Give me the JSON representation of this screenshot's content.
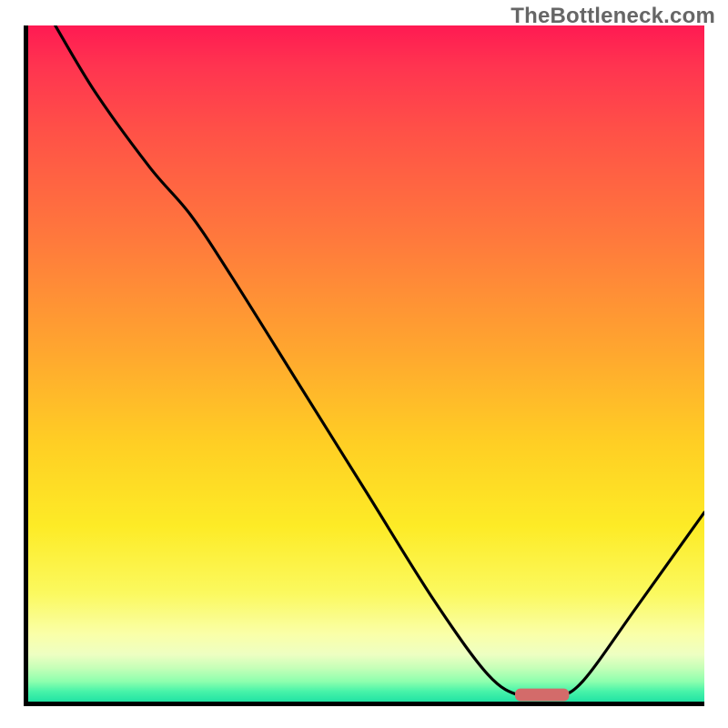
{
  "watermark": "TheBottleneck.com",
  "chart_data": {
    "type": "line",
    "title": "",
    "xlabel": "",
    "ylabel": "",
    "ylim": [
      0,
      100
    ],
    "xlim": [
      0,
      100
    ],
    "legend": false,
    "grid": false,
    "curve_points": [
      {
        "x": 4,
        "y": 100
      },
      {
        "x": 10,
        "y": 90
      },
      {
        "x": 18,
        "y": 79
      },
      {
        "x": 24,
        "y": 72
      },
      {
        "x": 30,
        "y": 63
      },
      {
        "x": 40,
        "y": 47
      },
      {
        "x": 50,
        "y": 31
      },
      {
        "x": 60,
        "y": 15
      },
      {
        "x": 68,
        "y": 4
      },
      {
        "x": 73,
        "y": 0.8
      },
      {
        "x": 78,
        "y": 0.8
      },
      {
        "x": 82,
        "y": 3
      },
      {
        "x": 90,
        "y": 14
      },
      {
        "x": 100,
        "y": 28
      }
    ],
    "optimal_zone": {
      "x_start": 72,
      "x_end": 80,
      "y": 1
    },
    "marker_color": "#d36b6a",
    "curve_color": "#000000",
    "gradient_stops": [
      {
        "pos": 0,
        "color": "#ff1a52"
      },
      {
        "pos": 0.5,
        "color": "#ffcf24"
      },
      {
        "pos": 0.9,
        "color": "#faffa8"
      },
      {
        "pos": 1.0,
        "color": "#22e3a4"
      }
    ]
  }
}
